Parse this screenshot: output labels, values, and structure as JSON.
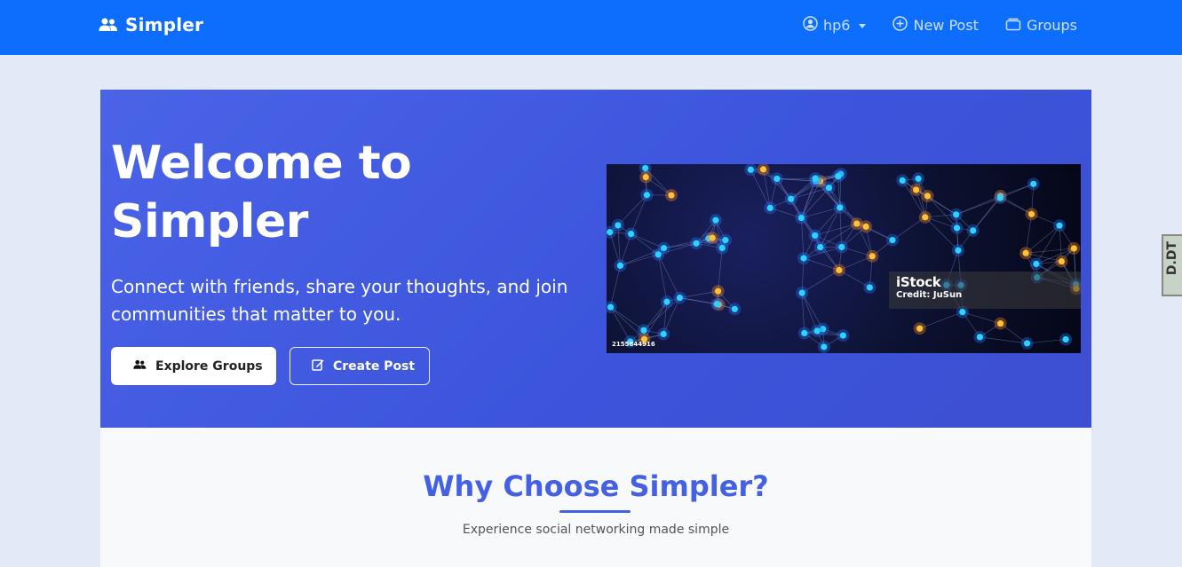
{
  "navbar": {
    "brand": "Simpler",
    "user_menu": "hp6",
    "new_post": "New Post",
    "groups": "Groups"
  },
  "hero": {
    "title": "Welcome to Simpler",
    "subtitle": "Connect with friends, share your thoughts, and join communities that matter to you.",
    "explore_button": "Explore Groups",
    "create_button": "Create Post",
    "image": {
      "watermark_brand": "iStock",
      "credit": "Credit: JuSun",
      "stock_id": "2155844916"
    }
  },
  "features": {
    "title": "Why Choose Simpler?",
    "subtitle": "Experience social networking made simple"
  },
  "edge_tab": {
    "label": "D.DT"
  },
  "colors": {
    "navbar": "#0d6efd",
    "hero_start": "#4a63e7",
    "hero_end": "#3d4fd2",
    "page_bg": "#e1eaf6",
    "accent": "#4561e3"
  },
  "icons": {
    "brand": "users-icon",
    "user": "user-circle-icon",
    "new_post": "plus-circle-icon",
    "groups": "collection-icon",
    "explore": "users-icon",
    "create": "edit-icon"
  }
}
